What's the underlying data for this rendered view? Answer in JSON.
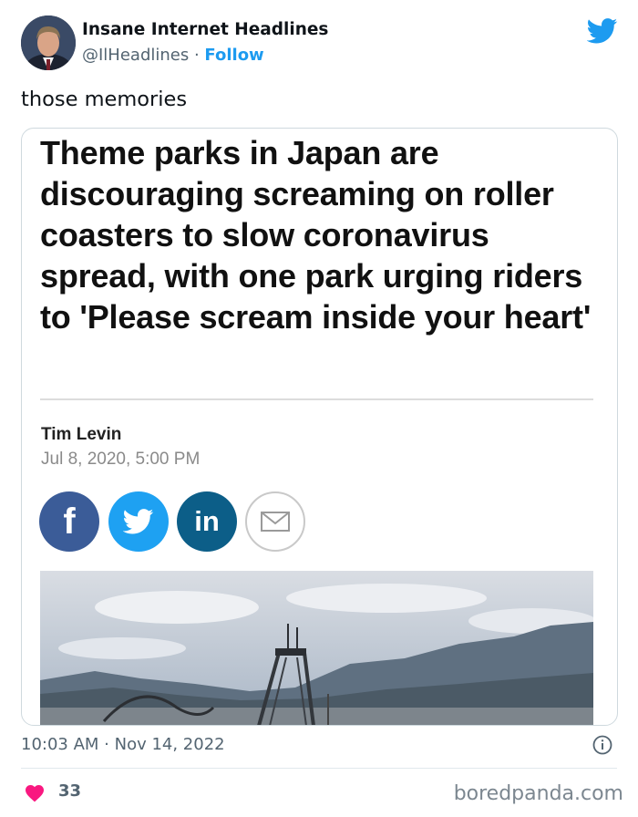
{
  "tweet": {
    "author_name": "Insane Internet Headlines",
    "handle": "@IlHeadlines",
    "separator": " · ",
    "follow_label": "Follow",
    "text": "those memories",
    "timestamp": "10:03 AM · Nov 14, 2022",
    "likes": "33"
  },
  "article": {
    "headline": "Theme parks in Japan are discouraging screaming on roller coasters to slow coronavirus spread, with one park urging riders to 'Please scream inside your heart'",
    "author": "Tim Levin",
    "date": "Jul 8, 2020, 5:00 PM",
    "share_buttons": [
      {
        "network": "facebook",
        "glyph": "f",
        "color": "#3b5c98"
      },
      {
        "network": "twitter",
        "color": "#1ea1f2"
      },
      {
        "network": "linkedin",
        "glyph": "in",
        "color": "#0c5e88"
      },
      {
        "network": "email",
        "color": "#ffffff"
      }
    ]
  },
  "watermark": "boredpanda.com",
  "colors": {
    "accent": "#1d9bf0",
    "text": "#0f1419",
    "muted": "#536471",
    "like": "#f91880"
  }
}
